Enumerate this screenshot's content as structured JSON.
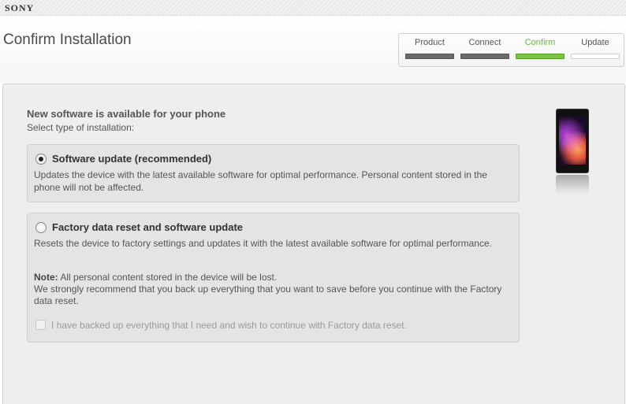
{
  "brand": "SONY",
  "page_title": "Confirm Installation",
  "steps": [
    {
      "label": "Product",
      "state": "done"
    },
    {
      "label": "Connect",
      "state": "done"
    },
    {
      "label": "Confirm",
      "state": "active"
    },
    {
      "label": "Update",
      "state": "pending"
    }
  ],
  "intro": {
    "title": "New software is available for your phone",
    "subtitle": "Select type of installation:"
  },
  "options": [
    {
      "title": "Software update (recommended)",
      "description": "Updates the device with the latest available software for optimal performance. Personal content stored in the phone will not be affected.",
      "selected": true
    },
    {
      "title": "Factory data reset and software update",
      "description": "Resets the device to factory settings and updates it with the latest available software for optimal performance.",
      "note_label": "Note:",
      "note_text": "All personal content stored in the device will be lost.",
      "note_text2": "We strongly recommend that you back up everything that you want to save before you continue with the Factory data reset.",
      "checkbox_label": "I have backed up everything that I need and wish to continue with Factory data reset.",
      "selected": false,
      "checkbox_checked": false,
      "checkbox_enabled": false
    }
  ],
  "icons": {
    "phone": "phone-image-icon"
  },
  "colors": {
    "accent": "#7cc242",
    "step_done": "#6a6a6a"
  }
}
